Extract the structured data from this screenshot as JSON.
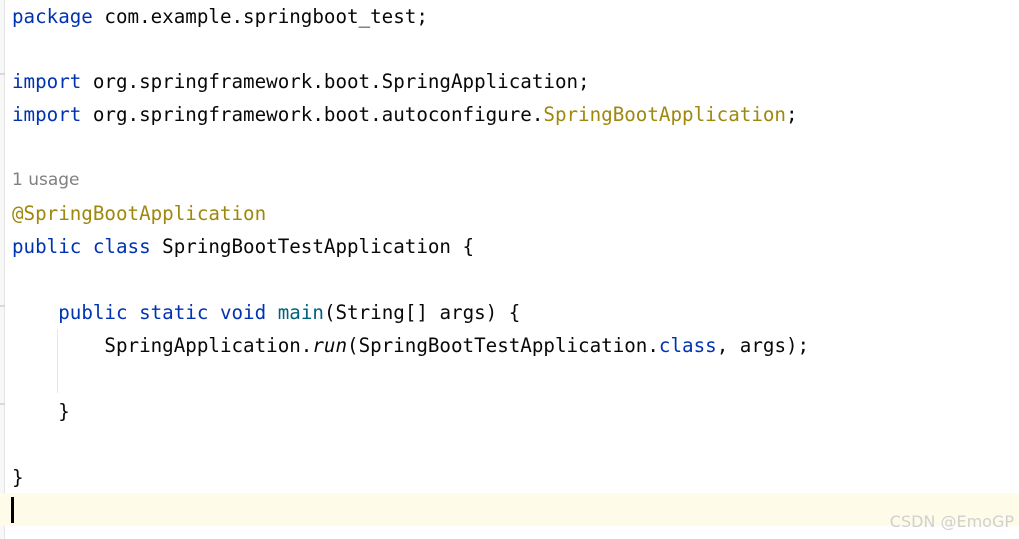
{
  "editor": {
    "line_package": {
      "keyword": "package",
      "rest": " com.example.springboot_test;"
    },
    "line_import_1": {
      "keyword": "import",
      "rest": " org.springframework.boot.SpringApplication;"
    },
    "line_import_2": {
      "keyword": "import",
      "path": " org.springframework.boot.autoconfigure.",
      "annotation_class": "SpringBootApplication",
      "semicolon": ";"
    },
    "usage_hint": "1 usage",
    "line_annotation": "@SpringBootApplication",
    "line_class": {
      "kw_public": "public",
      "kw_class": " class",
      "rest": " SpringBootTestApplication {"
    },
    "line_main": {
      "indent": "    ",
      "kw_public": "public",
      "kw_static": " static",
      "kw_void": " void",
      "space": " ",
      "fn_name": "main",
      "rest": "(String[] args) {"
    },
    "line_run": {
      "indent": "        ",
      "obj": "SpringApplication.",
      "method": "run",
      "args_a": "(SpringBootTestApplication.",
      "kw_class": "class",
      "args_b": ", args);"
    },
    "line_close_method": "    }",
    "line_close_class": "}"
  },
  "watermark": "CSDN @EmoGP",
  "colors": {
    "keyword": "#0033b3",
    "annotation": "#9e880d",
    "method_declaration": "#00627a",
    "plain_text": "#080808",
    "hint_text": "#808080",
    "current_line_background": "#fefbe8"
  }
}
